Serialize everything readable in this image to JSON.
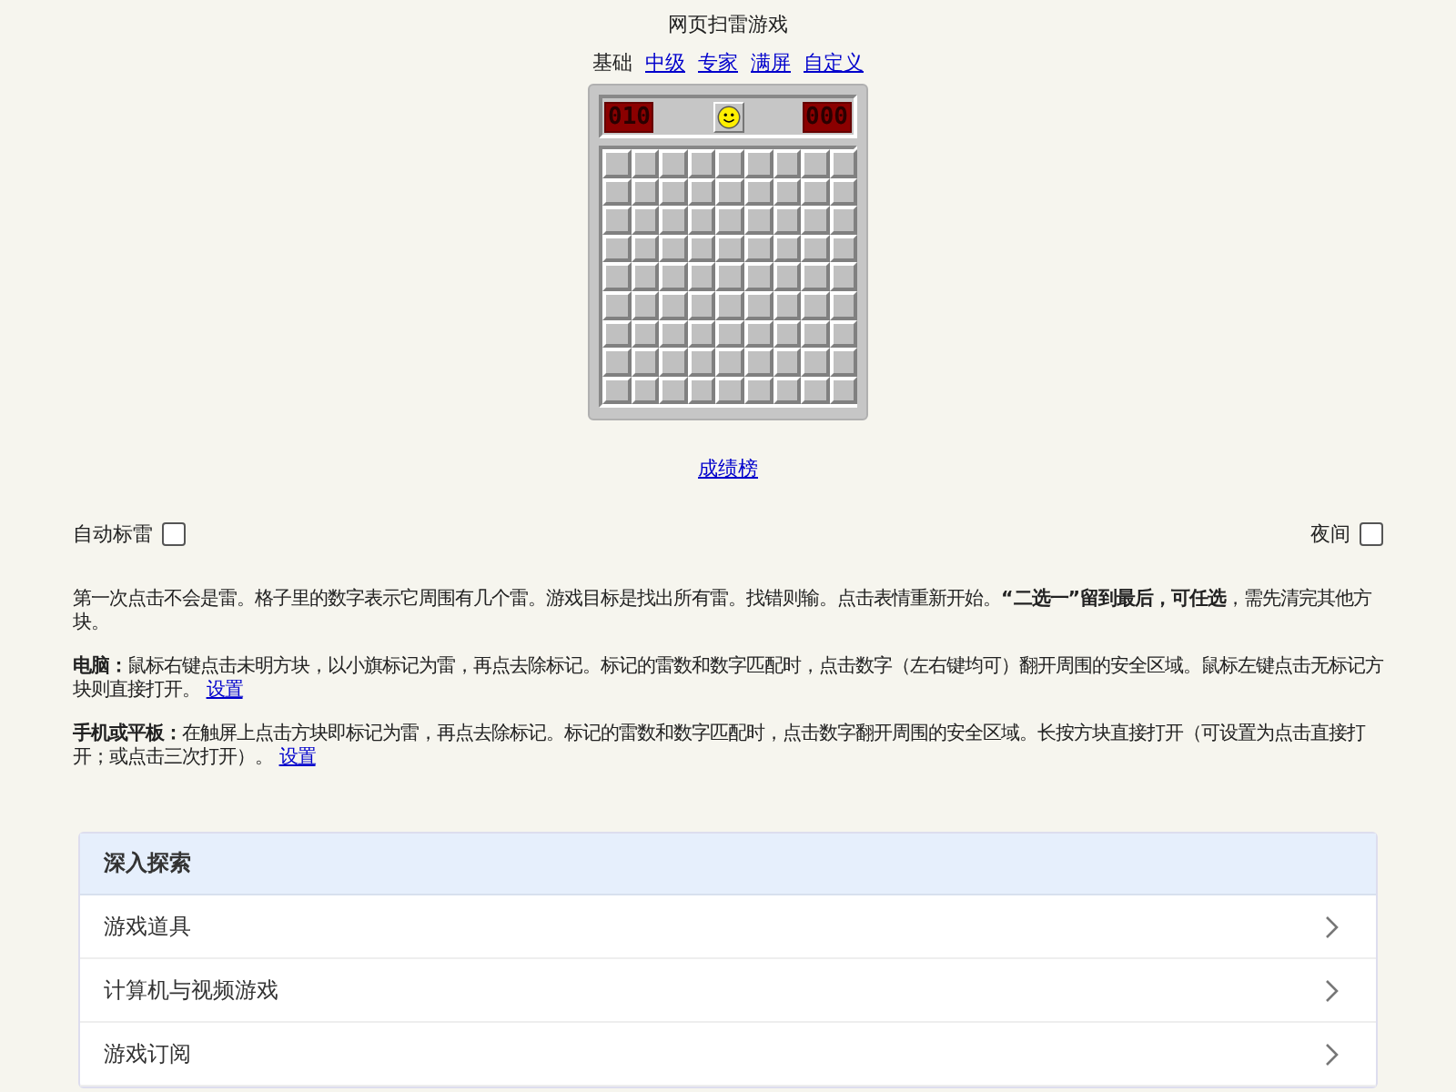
{
  "title": "网页扫雷游戏",
  "levels": [
    {
      "label": "基础",
      "selected": true
    },
    {
      "label": "中级",
      "selected": false
    },
    {
      "label": "专家",
      "selected": false
    },
    {
      "label": "满屏",
      "selected": false
    },
    {
      "label": "自定义",
      "selected": false
    }
  ],
  "game": {
    "mine_counter": "010",
    "timer": "000",
    "cells": [
      [
        {
          "opened": false
        },
        {
          "opened": false
        },
        {
          "opened": false
        },
        {
          "opened": false
        },
        {
          "opened": false
        },
        {
          "opened": false
        },
        {
          "opened": false
        },
        {
          "opened": false
        },
        {
          "opened": false
        }
      ],
      [
        {
          "opened": false
        },
        {
          "opened": false
        },
        {
          "opened": false
        },
        {
          "opened": false
        },
        {
          "opened": false
        },
        {
          "opened": false
        },
        {
          "opened": false
        },
        {
          "opened": false
        },
        {
          "opened": false
        }
      ],
      [
        {
          "opened": false
        },
        {
          "opened": false
        },
        {
          "opened": false
        },
        {
          "opened": false
        },
        {
          "opened": false
        },
        {
          "opened": false
        },
        {
          "opened": false
        },
        {
          "opened": false
        },
        {
          "opened": false
        }
      ],
      [
        {
          "opened": false
        },
        {
          "opened": false
        },
        {
          "opened": false
        },
        {
          "opened": false
        },
        {
          "opened": false
        },
        {
          "opened": false
        },
        {
          "opened": false
        },
        {
          "opened": false
        },
        {
          "opened": false
        }
      ],
      [
        {
          "opened": false
        },
        {
          "opened": false
        },
        {
          "opened": false
        },
        {
          "opened": false
        },
        {
          "opened": false
        },
        {
          "opened": false
        },
        {
          "opened": false
        },
        {
          "opened": false
        },
        {
          "opened": false
        }
      ],
      [
        {
          "opened": false
        },
        {
          "opened": false
        },
        {
          "opened": false
        },
        {
          "opened": false
        },
        {
          "opened": false
        },
        {
          "opened": false
        },
        {
          "opened": false
        },
        {
          "opened": false
        },
        {
          "opened": false
        }
      ],
      [
        {
          "opened": false
        },
        {
          "opened": false
        },
        {
          "opened": false
        },
        {
          "opened": false
        },
        {
          "opened": false
        },
        {
          "opened": false
        },
        {
          "opened": false
        },
        {
          "opened": false
        },
        {
          "opened": false
        }
      ],
      [
        {
          "opened": false
        },
        {
          "opened": false
        },
        {
          "opened": false
        },
        {
          "opened": false
        },
        {
          "opened": false
        },
        {
          "opened": false
        },
        {
          "opened": false
        },
        {
          "opened": false
        },
        {
          "opened": false
        }
      ],
      [
        {
          "opened": false
        },
        {
          "opened": false
        },
        {
          "opened": false
        },
        {
          "opened": false
        },
        {
          "opened": false
        },
        {
          "opened": false
        },
        {
          "opened": false
        },
        {
          "opened": false
        },
        {
          "opened": false
        }
      ]
    ]
  },
  "leaderboard_link": "成绩榜",
  "options": [
    {
      "label": "自动标雷",
      "checked": false
    },
    {
      "label": "夜间",
      "checked": false
    }
  ],
  "paragraphs": [
    {
      "text": "第一次点击不会是雷。格子里的数字表示它周围有几个雷。游戏目标是找出所有雷。找错则输。点击表情重新开始。**“二选一”留到最后，可任选**，需先清完其他方块。"
    },
    {
      "text": "**电脑：**鼠标右键点击未明方块，以小旗标记为雷，再点去除标记。标记的雷数和数字匹配时，点击数字（左右键均可）翻开周围的安全区域。鼠标左键点击无标记方块则直接打开。",
      "link": "设置"
    },
    {
      "text": "**手机或平板：**在触屏上点击方块即标记为雷，再点去除标记。标记的雷数和数字匹配时，点击数字翻开周围的安全区域。长按方块直接打开（可设置为点击直接打开；或点击三次打开）。",
      "link": "设置"
    }
  ],
  "explore": {
    "header": "深入探索",
    "items": [
      "游戏道具",
      "计算机与视频游戏",
      "游戏订阅"
    ]
  }
}
